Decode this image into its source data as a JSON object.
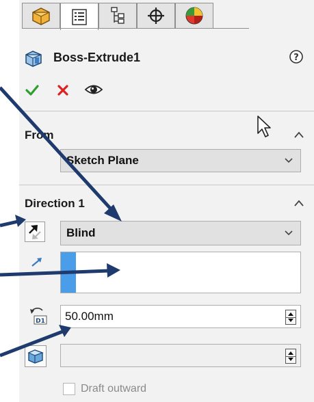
{
  "tabs": [
    {
      "icon": "feature-tree-icon",
      "active": false
    },
    {
      "icon": "property-manager-icon",
      "active": true
    },
    {
      "icon": "configuration-manager-icon",
      "active": false
    },
    {
      "icon": "dimxpert-manager-icon",
      "active": false
    },
    {
      "icon": "display-manager-icon",
      "active": false
    }
  ],
  "feature": {
    "title": "Boss-Extrude1",
    "icon": "boss-extrude-icon",
    "help_icon": "help-icon",
    "ok_icon": "ok-checkmark-icon",
    "cancel_icon": "cancel-x-icon",
    "preview_icon": "eye-preview-icon"
  },
  "from_group": {
    "title": "From",
    "selected": "Sketch Plane"
  },
  "direction1": {
    "title": "Direction 1",
    "end_condition": "Blind",
    "depth": "50.00mm",
    "draft_label": "Draft outward",
    "draft_checked": false
  },
  "colors": {
    "panel": "#f2f2f2",
    "annotation_arrow": "#1f3b6e",
    "ok": "#2e9e2e",
    "cancel": "#e02020",
    "selection": "#4a9de8"
  }
}
